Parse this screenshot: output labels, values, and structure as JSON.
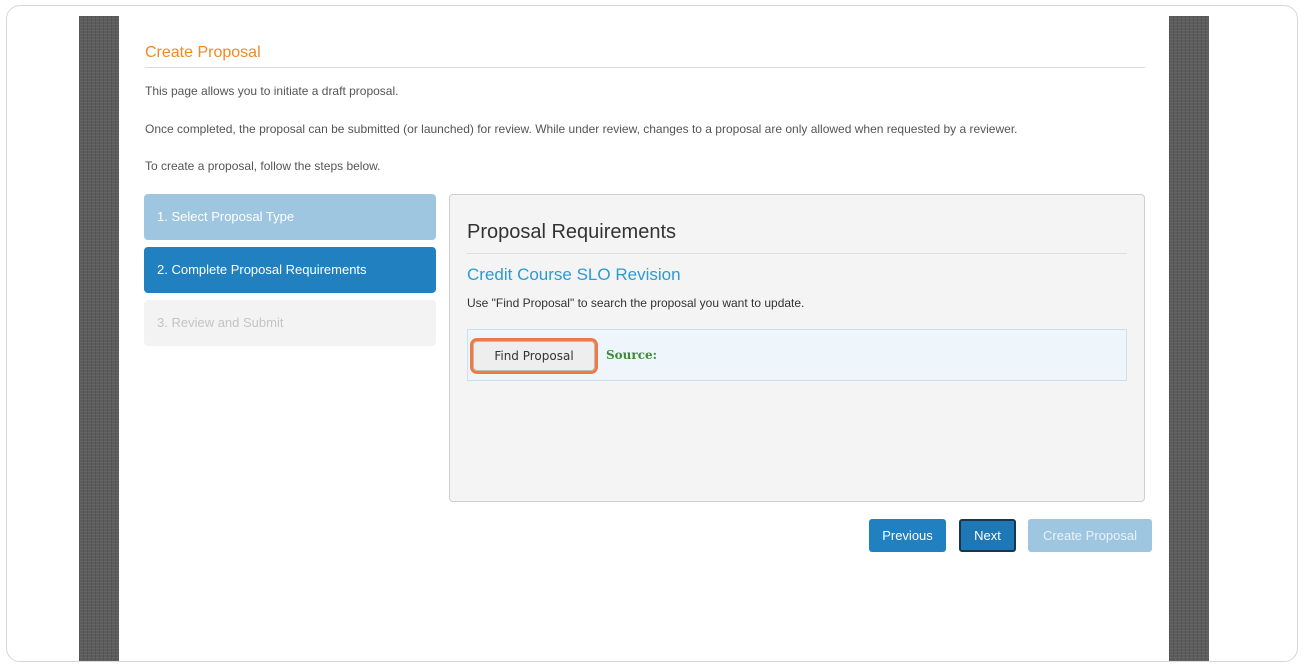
{
  "page": {
    "title": "Create Proposal",
    "intro_line_1": "This page allows you to initiate a draft proposal.",
    "intro_line_2": "Once completed, the proposal can be submitted (or launched) for review. While under review, changes to a proposal are only allowed when requested by a reviewer.",
    "intro_line_3": "To create a proposal, follow the steps below."
  },
  "steps": [
    {
      "label": "1. Select Proposal Type",
      "state": "done"
    },
    {
      "label": "2. Complete Proposal Requirements",
      "state": "active"
    },
    {
      "label": "3. Review and Submit",
      "state": "disabled"
    }
  ],
  "panel": {
    "heading": "Proposal Requirements",
    "proposal_type": "Credit Course SLO Revision",
    "note": "Use \"Find Proposal\" to search the proposal you want to update.",
    "find_button": "Find Proposal",
    "source_label": "Source:"
  },
  "actions": {
    "previous": "Previous",
    "next": "Next",
    "create": "Create Proposal"
  },
  "colors": {
    "accent_orange": "#f08a24",
    "primary_blue": "#2180bf",
    "light_blue": "#9ec6e0",
    "link_blue": "#2b9ad6",
    "highlight": "#f07a45",
    "source_green": "#3c8c35"
  }
}
